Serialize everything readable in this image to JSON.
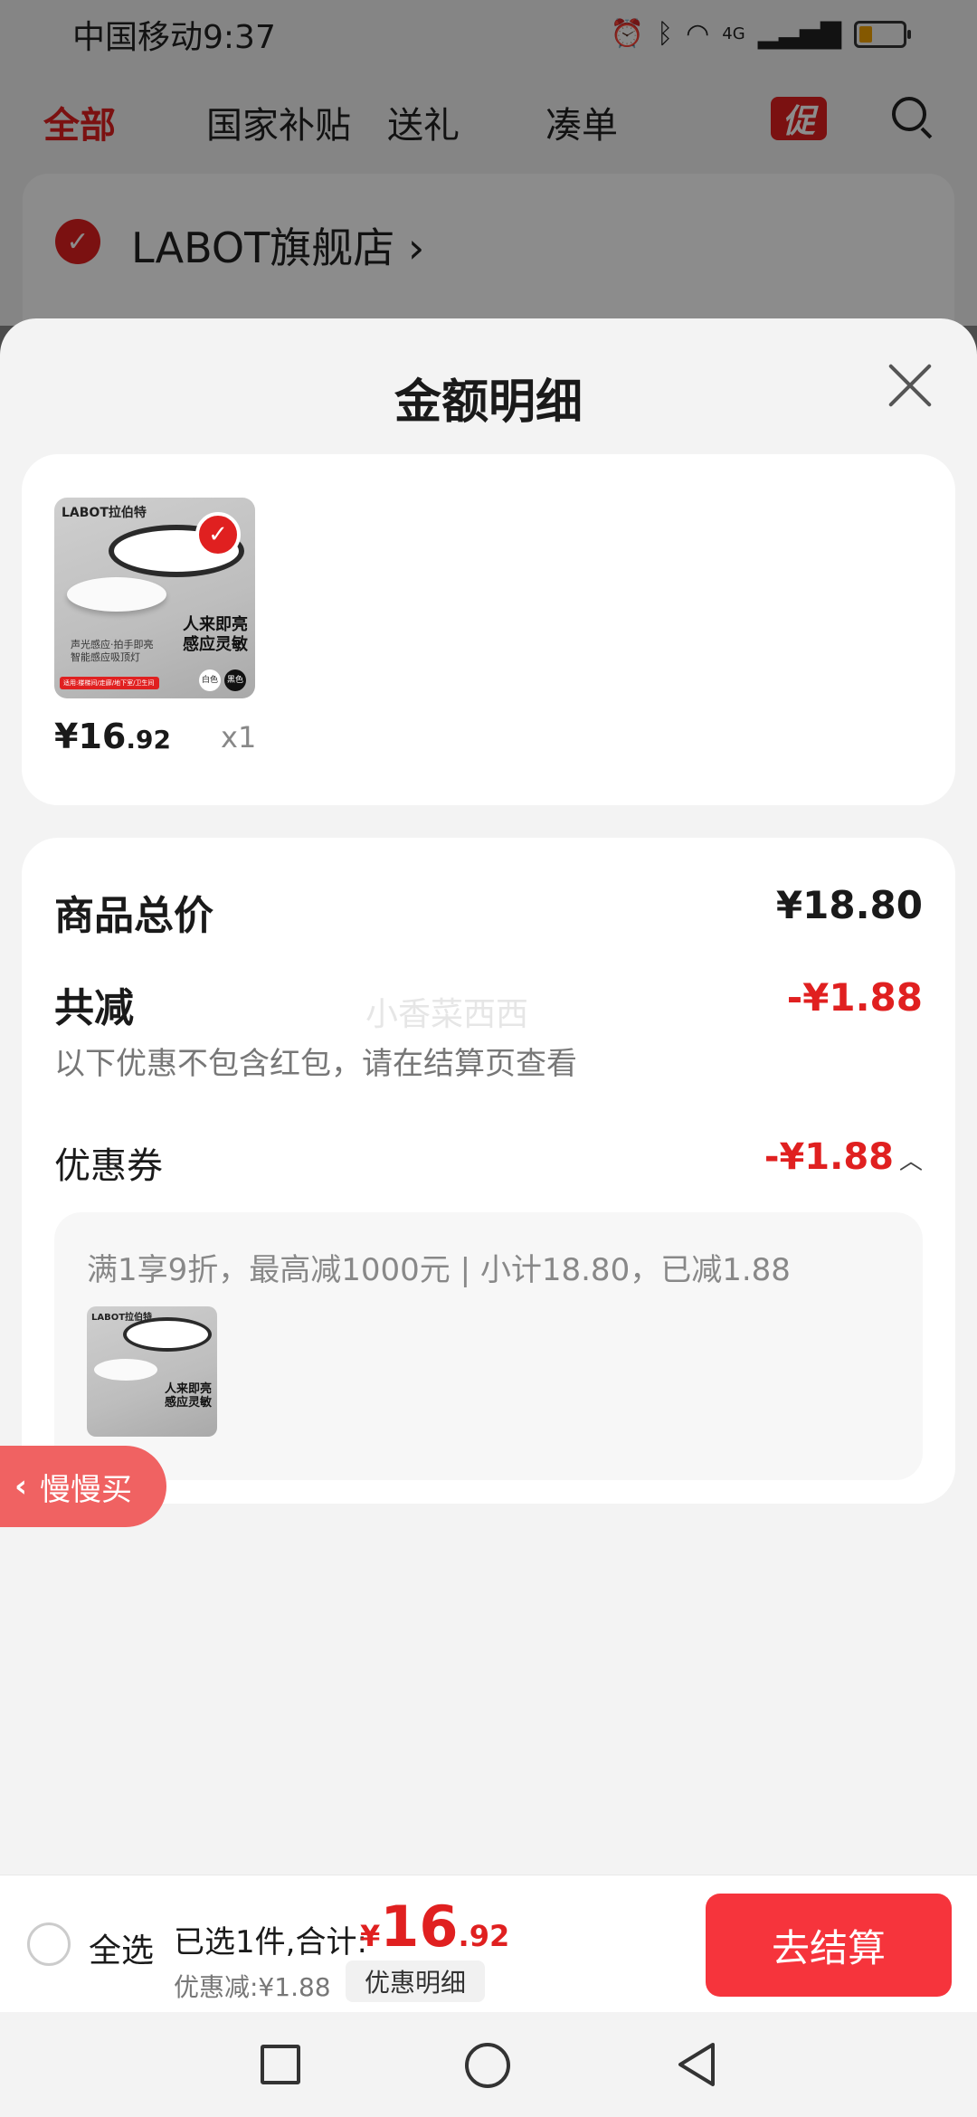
{
  "status_bar": {
    "carrier_time": "中国移动9:37",
    "signal_text": "4G"
  },
  "top_tabs": {
    "all": "全部",
    "subsidy": "国家补贴",
    "gift": "送礼",
    "bundle": "凑单",
    "promo_badge": "促"
  },
  "store": {
    "name": "LABOT旗舰店"
  },
  "sheet": {
    "title": "金额明细",
    "product": {
      "price_int": "¥16",
      "price_dec": ".92",
      "qty": "x1",
      "thumb_brand": "LABOT拉伯特",
      "thumb_headline_1": "人来即亮",
      "thumb_headline_2": "感应灵敏",
      "thumb_sub_1": "声光感应·拍手即亮",
      "thumb_sub_2": "智能感应吸顶灯",
      "thumb_strip": "适用:楼梯间/走廊/地下室/卫生间",
      "thumb_white": "白色",
      "thumb_black": "黑色"
    },
    "summary": {
      "total_label": "商品总价",
      "total_value": "¥18.80",
      "reduce_label": "共减",
      "reduce_value": "-¥1.88",
      "reduce_note": "以下优惠不包含红包，请在结算页查看",
      "watermark": "小香菜西西",
      "coupon_label": "优惠券",
      "coupon_value": "-¥1.88",
      "coupon_desc": "满1享9折，最高减1000元 | 小计18.80，已减1.88"
    }
  },
  "slow_buy": {
    "label": "慢慢买"
  },
  "bottom_bar": {
    "select_all": "全选",
    "selected_text": "已选1件,合计:",
    "total_currency": "¥",
    "total_int": "16",
    "total_dec": ".92",
    "discount_text": "优惠减:¥1.88",
    "detail_button": "优惠明细",
    "checkout_button": "去结算"
  },
  "colors": {
    "accent_red": "#e02020",
    "checkout_red": "#f6343c"
  }
}
